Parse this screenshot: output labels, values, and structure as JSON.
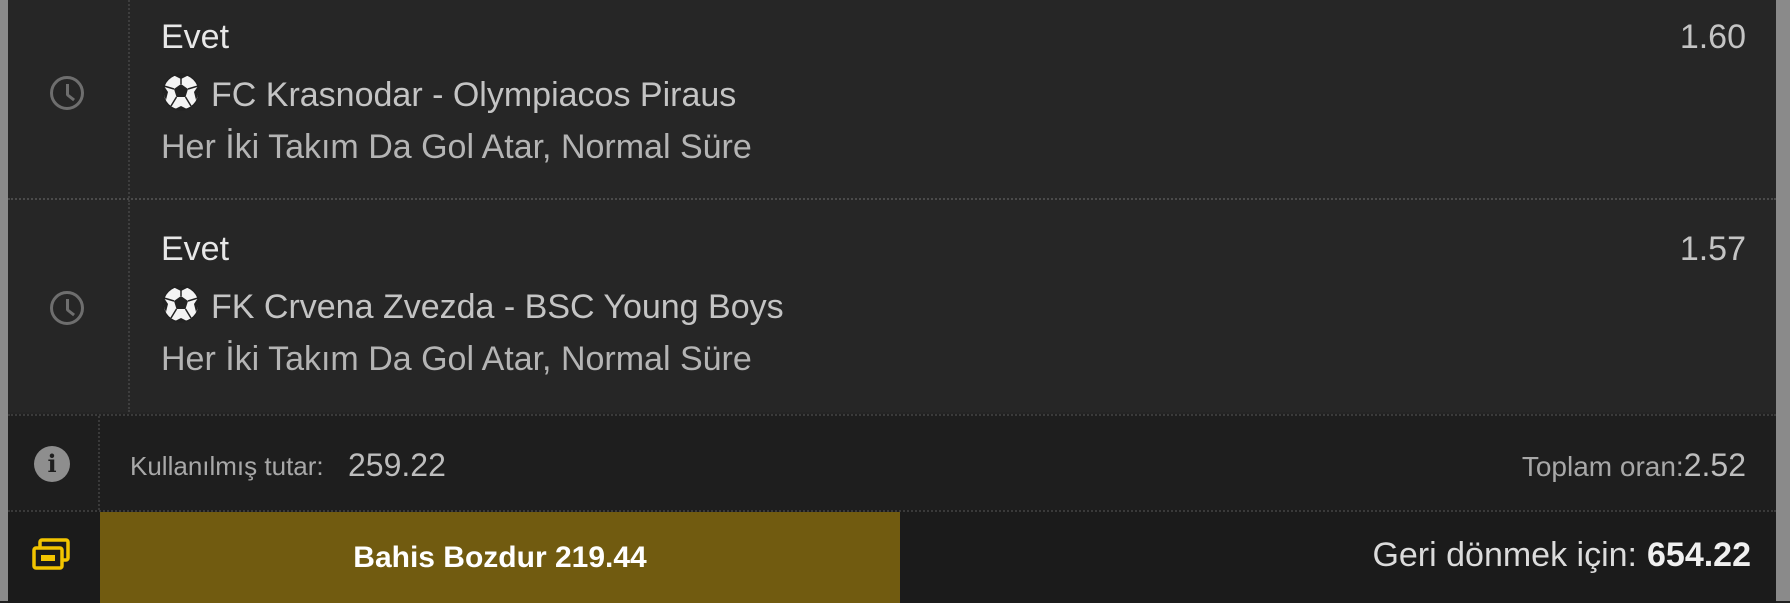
{
  "selections": [
    {
      "pick": "Evet",
      "odds": "1.60",
      "match": "FC Krasnodar - Olympiacos Piraus",
      "market": "Her İki Takım Da Gol Atar, Normal Süre",
      "sport_icon": "soccer-ball-icon",
      "status_icon": "clock-icon"
    },
    {
      "pick": "Evet",
      "odds": "1.57",
      "match": "FK Crvena Zvezda - BSC Young Boys",
      "market": "Her İki Takım Da Gol Atar, Normal Süre",
      "sport_icon": "soccer-ball-icon",
      "status_icon": "clock-icon"
    }
  ],
  "summary": {
    "used_label": "Kullanılmış tutar:",
    "used_value": "259.22",
    "total_odds_label": "Toplam oran:",
    "total_odds_value": "2.52"
  },
  "actions": {
    "cashout_label": "Bahis Bozdur 219.44",
    "return_label": "Geri dönmek için:",
    "return_value": "654.22"
  },
  "colors": {
    "accent": "#715b10",
    "accent_icon": "#f2c400",
    "background": "#242424"
  }
}
